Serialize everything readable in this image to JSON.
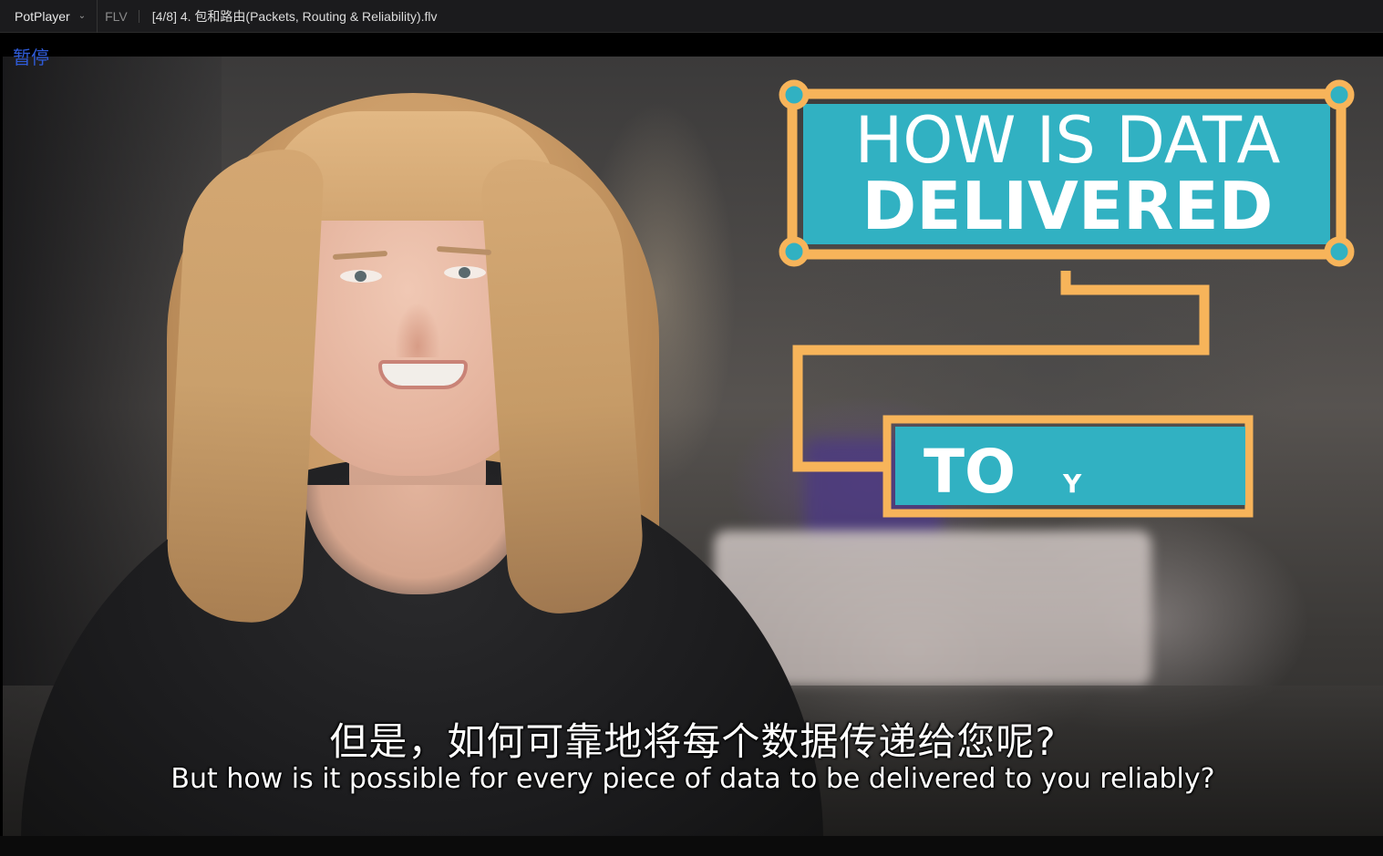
{
  "titlebar": {
    "app_name": "PotPlayer",
    "format": "FLV",
    "file_title": "[4/8] 4. 包和路由(Packets, Routing & Reliability).flv"
  },
  "osd": {
    "status": "暂停"
  },
  "graphic": {
    "line1": "HOW IS DATA",
    "line2": "DELIVERED",
    "box2_word1": "TO",
    "box2_word2": "Y",
    "teal_color": "#31b1c2",
    "orange_color": "#f7b45a"
  },
  "subtitles": {
    "chinese": "但是，如何可靠地将每个数据传递给您呢?",
    "english": "But how is it possible for every piece of data to be delivered to you reliably?"
  },
  "icons": {
    "app_menu_chevron": "chevron-down-icon"
  }
}
